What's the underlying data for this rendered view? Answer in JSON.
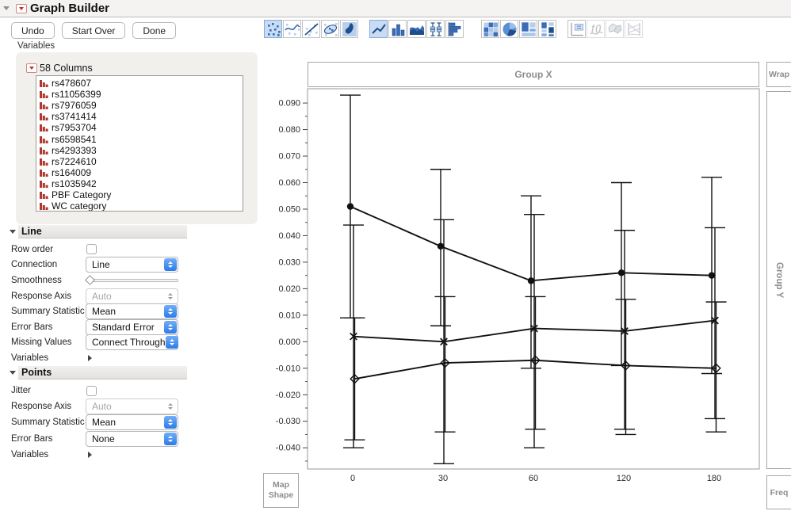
{
  "window": {
    "title": "Graph Builder",
    "variables_label": "Variables"
  },
  "toolbar": {
    "buttons": [
      {
        "label": "Undo"
      },
      {
        "label": "Start Over"
      },
      {
        "label": "Done"
      }
    ],
    "icon_groups": [
      {
        "icons": [
          {
            "name": "points",
            "selected": true
          },
          {
            "name": "smoother"
          },
          {
            "name": "line-of-fit"
          },
          {
            "name": "density-ellipse"
          },
          {
            "name": "contour"
          }
        ]
      },
      {
        "icons": [
          {
            "name": "line",
            "selected": true
          },
          {
            "name": "bar"
          },
          {
            "name": "area"
          },
          {
            "name": "box-plot"
          },
          {
            "name": "histogram"
          }
        ]
      },
      {
        "icons": [
          {
            "name": "heatmap"
          },
          {
            "name": "pie"
          },
          {
            "name": "treemap"
          },
          {
            "name": "mosaic"
          }
        ]
      },
      {
        "icons": [
          {
            "name": "caption-box"
          },
          {
            "name": "formula",
            "disabled": true
          },
          {
            "name": "map-shape",
            "disabled": true
          },
          {
            "name": "parallel",
            "disabled": true
          }
        ]
      }
    ]
  },
  "variables_panel": {
    "header": "58 Columns",
    "columns": [
      "rs478607",
      "rs11056399",
      "rs7976059",
      "rs3741414",
      "rs7953704",
      "rs6598541",
      "rs4293393",
      "rs7224610",
      "rs164009",
      "rs1035942",
      "PBF Category",
      "WC category"
    ]
  },
  "line_section": {
    "title": "Line",
    "rows": [
      {
        "label": "Row order",
        "control": "checkbox",
        "checked": false
      },
      {
        "label": "Connection",
        "control": "select",
        "value": "Line",
        "enabled": true
      },
      {
        "label": "Smoothness",
        "control": "slider",
        "position": 0
      },
      {
        "label": "Response Axis",
        "control": "select",
        "value": "Auto",
        "enabled": false
      },
      {
        "label": "Summary Statistic",
        "control": "select",
        "value": "Mean",
        "enabled": true
      },
      {
        "label": "Error Bars",
        "control": "select",
        "value": "Standard Error",
        "enabled": true
      },
      {
        "label": "Missing Values",
        "control": "select",
        "value": "Connect Through",
        "enabled": true
      },
      {
        "label": "Variables",
        "control": "disclosure"
      }
    ]
  },
  "points_section": {
    "title": "Points",
    "rows": [
      {
        "label": "Jitter",
        "control": "checkbox",
        "checked": false
      },
      {
        "label": "Response Axis",
        "control": "select",
        "value": "Auto",
        "enabled": false
      },
      {
        "label": "Summary Statistic",
        "control": "select",
        "value": "Mean",
        "enabled": true
      },
      {
        "label": "Error Bars",
        "control": "select",
        "value": "None",
        "enabled": true
      },
      {
        "label": "Variables",
        "control": "disclosure"
      }
    ]
  },
  "chart_data": {
    "type": "line",
    "title": "",
    "zones": {
      "x_group": "Group X",
      "y_group": "Group Y",
      "wrap": "Wrap",
      "freq": "Freq",
      "map_shape": "Map Shape"
    },
    "categories": [
      "0",
      "30",
      "60",
      "120",
      "180"
    ],
    "xlabel": "",
    "ylabel": "",
    "y_axis": {
      "min": -0.048,
      "max": 0.0954,
      "tick_start": -0.04,
      "tick_end": 0.09,
      "major_step": 0.01,
      "minor_step": 0.005,
      "decimals": 3
    },
    "summary_statistic": "Mean",
    "error_bars": "Standard Error",
    "grid": false,
    "legend": "none",
    "series": [
      {
        "name": "series-circle",
        "marker": "circle",
        "means": [
          0.051,
          0.036,
          0.023,
          0.026,
          0.025
        ],
        "upper": [
          0.093,
          0.065,
          0.055,
          0.06,
          0.062
        ],
        "lower": [
          0.009,
          0.006,
          -0.01,
          -0.009,
          -0.012
        ]
      },
      {
        "name": "series-x",
        "marker": "x",
        "means": [
          0.002,
          0.0,
          0.005,
          0.004,
          0.008
        ],
        "upper": [
          0.044,
          0.046,
          0.048,
          0.042,
          0.043
        ],
        "lower": [
          -0.04,
          -0.046,
          -0.04,
          -0.033,
          -0.029
        ]
      },
      {
        "name": "series-diamond",
        "marker": "diamond",
        "means": [
          -0.014,
          -0.008,
          -0.007,
          -0.009,
          -0.01
        ],
        "upper": [
          0.009,
          0.017,
          0.017,
          0.016,
          0.015
        ],
        "lower": [
          -0.037,
          -0.034,
          -0.033,
          -0.035,
          -0.034
        ]
      }
    ]
  },
  "colors": {
    "accent_blue": "#2d7ae8",
    "icon_blue": "#3a6cb8",
    "icon_blue_dark": "#1f4e8c",
    "icon_blue_light": "#b8cfec",
    "marker_red": "#b0372f",
    "zone_text": "#8d8d8d",
    "series_stroke": "#111111"
  }
}
